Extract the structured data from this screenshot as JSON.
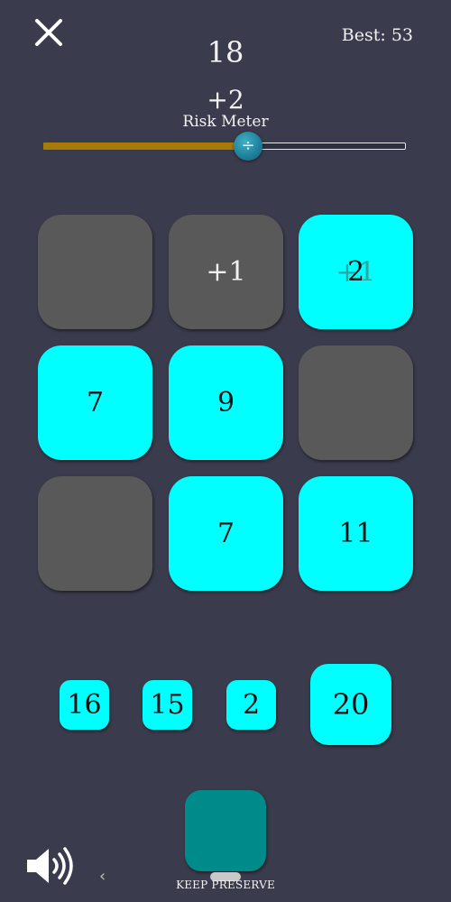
{
  "header": {
    "score": "18",
    "best": "Best: 53",
    "increment": "+2",
    "meter_label": "Risk Meter"
  },
  "risk_meter": {
    "level_fraction": 0.55,
    "knob_symbol": "÷",
    "fill_color": "#a87b08"
  },
  "board": {
    "tiles": [
      {
        "value": "",
        "state": "empty"
      },
      {
        "value": "+1",
        "state": "empty"
      },
      {
        "value": "2",
        "ghost": "+1",
        "state": "filled"
      },
      {
        "value": "7",
        "state": "filled"
      },
      {
        "value": "9",
        "state": "filled"
      },
      {
        "value": "",
        "state": "empty"
      },
      {
        "value": "",
        "state": "empty"
      },
      {
        "value": "7",
        "state": "filled"
      },
      {
        "value": "11",
        "state": "filled"
      }
    ]
  },
  "queue": {
    "items": [
      "16",
      "15",
      "2",
      "20"
    ]
  },
  "bottom": {
    "keep_label": "KEEP PRESERVE",
    "sound_icon": "speaker-volume-icon",
    "back_icon": "chevron-left-icon"
  },
  "colors": {
    "background": "#3a3b4c",
    "tile_empty": "#595959",
    "tile_filled": "#00ffff",
    "keep_button": "#008b8b"
  }
}
